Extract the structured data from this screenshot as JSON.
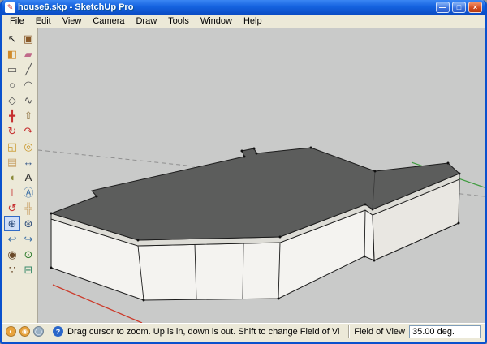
{
  "window": {
    "title": "house6.skp - SketchUp Pro",
    "controls": {
      "minimize": "—",
      "maximize": "□",
      "close": "×"
    },
    "logo_glyph": "✎"
  },
  "menubar": {
    "items": [
      "File",
      "Edit",
      "View",
      "Camera",
      "Draw",
      "Tools",
      "Window",
      "Help"
    ]
  },
  "toolbar": {
    "tools": [
      {
        "name": "select",
        "label": "Select",
        "glyph": "↖",
        "color": "#1a1a1a"
      },
      {
        "name": "make-component",
        "label": "Make Component",
        "glyph": "▣",
        "color": "#8a5a2a"
      },
      {
        "name": "paint-bucket",
        "label": "Paint Bucket",
        "glyph": "◧",
        "color": "#d08a2a"
      },
      {
        "name": "eraser",
        "label": "Eraser",
        "glyph": "▰",
        "color": "#c06a8a"
      },
      {
        "name": "rectangle",
        "label": "Rectangle",
        "glyph": "▭",
        "color": "#555555"
      },
      {
        "name": "line",
        "label": "Line",
        "glyph": "╱",
        "color": "#555555"
      },
      {
        "name": "circle",
        "label": "Circle",
        "glyph": "○",
        "color": "#555555"
      },
      {
        "name": "arc",
        "label": "Arc",
        "glyph": "◠",
        "color": "#555555"
      },
      {
        "name": "polygon",
        "label": "Polygon",
        "glyph": "◇",
        "color": "#555555"
      },
      {
        "name": "freehand",
        "label": "Freehand",
        "glyph": "∿",
        "color": "#555555"
      },
      {
        "name": "move",
        "label": "Move",
        "glyph": "╋",
        "color": "#c62f2f"
      },
      {
        "name": "push-pull",
        "label": "Push/Pull",
        "glyph": "⇧",
        "color": "#8a6d3b"
      },
      {
        "name": "rotate",
        "label": "Rotate",
        "glyph": "↻",
        "color": "#c62f2f"
      },
      {
        "name": "follow-me",
        "label": "Follow Me",
        "glyph": "↷",
        "color": "#c62f2f"
      },
      {
        "name": "scale",
        "label": "Scale",
        "glyph": "◱",
        "color": "#c9972a"
      },
      {
        "name": "offset",
        "label": "Offset",
        "glyph": "◎",
        "color": "#c9972a"
      },
      {
        "name": "tape-measure",
        "label": "Tape Measure",
        "glyph": "▤",
        "color": "#c9a36a"
      },
      {
        "name": "dimension",
        "label": "Dimension",
        "glyph": "↔",
        "color": "#3a5a8a"
      },
      {
        "name": "protractor",
        "label": "Protractor",
        "glyph": "◖",
        "color": "#8a8a3a"
      },
      {
        "name": "text",
        "label": "Text",
        "glyph": "A",
        "color": "#2a2a2a"
      },
      {
        "name": "axes",
        "label": "Axes",
        "glyph": "⊥",
        "color": "#c62f2f"
      },
      {
        "name": "3d-text",
        "label": "3D Text",
        "glyph": "Ⓐ",
        "color": "#3a6ea5"
      },
      {
        "name": "orbit",
        "label": "Orbit",
        "glyph": "↺",
        "color": "#c62f2f"
      },
      {
        "name": "pan",
        "label": "Pan",
        "glyph": "╬",
        "color": "#c9a36a"
      },
      {
        "name": "zoom",
        "label": "Zoom",
        "glyph": "⊕",
        "color": "#2a4a7a",
        "active": true
      },
      {
        "name": "zoom-extents",
        "label": "Zoom Extents",
        "glyph": "⊛",
        "color": "#2a4a7a"
      },
      {
        "name": "previous",
        "label": "Previous",
        "glyph": "↩",
        "color": "#3a6ea5"
      },
      {
        "name": "next",
        "label": "Next",
        "glyph": "↪",
        "color": "#3a6ea5"
      },
      {
        "name": "position-camera",
        "label": "Position Camera",
        "glyph": "◉",
        "color": "#6a4a2a"
      },
      {
        "name": "look-around",
        "label": "Look Around",
        "glyph": "⊙",
        "color": "#2a7a2a"
      },
      {
        "name": "walk",
        "label": "Walk",
        "glyph": "∵",
        "color": "#6a4a2a"
      },
      {
        "name": "section-plane",
        "label": "Section Plane",
        "glyph": "⊟",
        "color": "#3a8a6a"
      }
    ]
  },
  "statusbar": {
    "icons": [
      {
        "name": "status-button-1",
        "glyph": "◐",
        "bg": "#e8a33d"
      },
      {
        "name": "status-button-2",
        "glyph": "◉",
        "bg": "#e8a33d"
      },
      {
        "name": "status-button-3",
        "glyph": "◯",
        "bg": "#9ab0c4"
      }
    ],
    "help_label": "?",
    "hint": "Drag cursor to zoom.  Up is in, down is out. Shift to change Field of View.",
    "fov_label": "Field of View",
    "fov_value": "35.00 deg."
  },
  "canvas": {
    "colors": {
      "sky": "#c9cac9",
      "roof": "#5c5d5c",
      "walls": "#f4f3f0",
      "walls-shade": "#e9e7e2",
      "fascia": "#dddcd6",
      "edge": "#1c1c1c",
      "axis-red": "#cc3a2a",
      "axis-green": "#3f9c3f",
      "axis-dashed": "#8f8f8f"
    }
  },
  "theme": {
    "frame": "#0a51cd",
    "chrome": "#ece9d8"
  }
}
